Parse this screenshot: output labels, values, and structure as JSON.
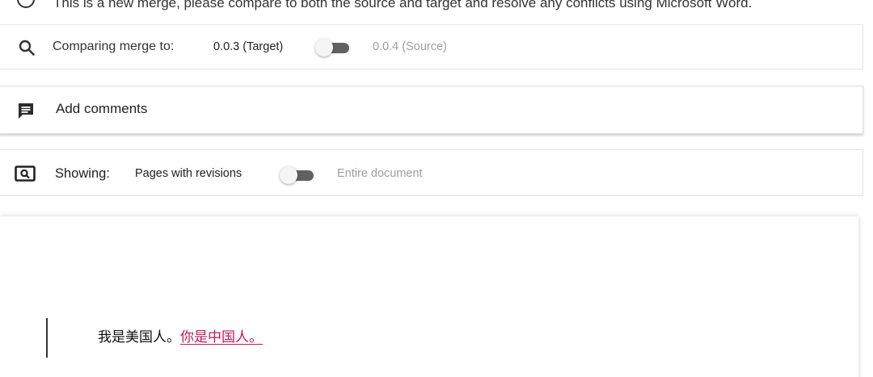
{
  "info": {
    "icon": "info-icon",
    "message": "This is a new merge, please compare to both the source and target and resolve any conflicts using Microsoft Word."
  },
  "compare": {
    "icon": "search-icon",
    "label": "Comparing merge to:",
    "target_label": "0.0.3 (Target)",
    "source_label": "0.0.4 (Source)",
    "toggle_state": "target"
  },
  "comments": {
    "icon": "comment-icon",
    "label": "Add comments"
  },
  "showing": {
    "icon": "view-icon",
    "label": "Showing:",
    "left_option": "Pages with revisions",
    "right_option": "Entire document",
    "toggle_state": "pages-with-revisions"
  },
  "document": {
    "original_text": "我是美国人。",
    "inserted_text": "你是中国人。",
    "colors": {
      "inserted": "#c2185b",
      "revision_bar": "#333333"
    }
  }
}
